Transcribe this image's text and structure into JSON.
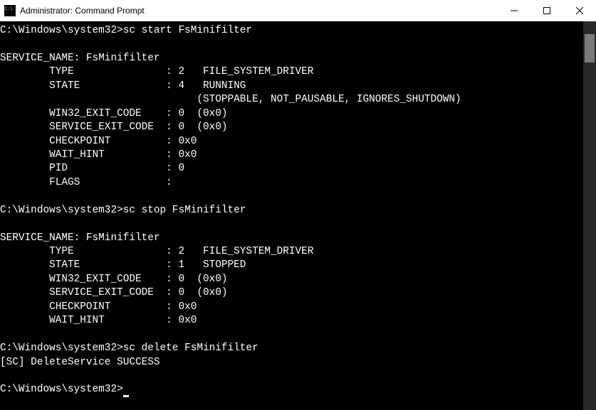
{
  "titlebar": {
    "title": "Administrator: Command Prompt"
  },
  "terminal": {
    "prompt": "C:\\Windows\\system32>",
    "commands": {
      "cmd1": "sc start FsMinifilter",
      "cmd2": "sc stop FsMinifilter",
      "cmd3": "sc delete FsMinifilter"
    },
    "output1": {
      "service_name_line": "SERVICE_NAME: FsMinifilter",
      "type_line": "        TYPE               : 2   FILE_SYSTEM_DRIVER",
      "state_line": "        STATE              : 4   RUNNING",
      "state_flags_line": "                                (STOPPABLE, NOT_PAUSABLE, IGNORES_SHUTDOWN)",
      "win32_exit_line": "        WIN32_EXIT_CODE    : 0  (0x0)",
      "service_exit_line": "        SERVICE_EXIT_CODE  : 0  (0x0)",
      "checkpoint_line": "        CHECKPOINT         : 0x0",
      "wait_hint_line": "        WAIT_HINT          : 0x0",
      "pid_line": "        PID                : 0",
      "flags_line": "        FLAGS              :"
    },
    "output2": {
      "service_name_line": "SERVICE_NAME: FsMinifilter",
      "type_line": "        TYPE               : 2   FILE_SYSTEM_DRIVER",
      "state_line": "        STATE              : 1   STOPPED",
      "win32_exit_line": "        WIN32_EXIT_CODE    : 0  (0x0)",
      "service_exit_line": "        SERVICE_EXIT_CODE  : 0  (0x0)",
      "checkpoint_line": "        CHECKPOINT         : 0x0",
      "wait_hint_line": "        WAIT_HINT          : 0x0"
    },
    "output3": {
      "result_line": "[SC] DeleteService SUCCESS"
    }
  }
}
